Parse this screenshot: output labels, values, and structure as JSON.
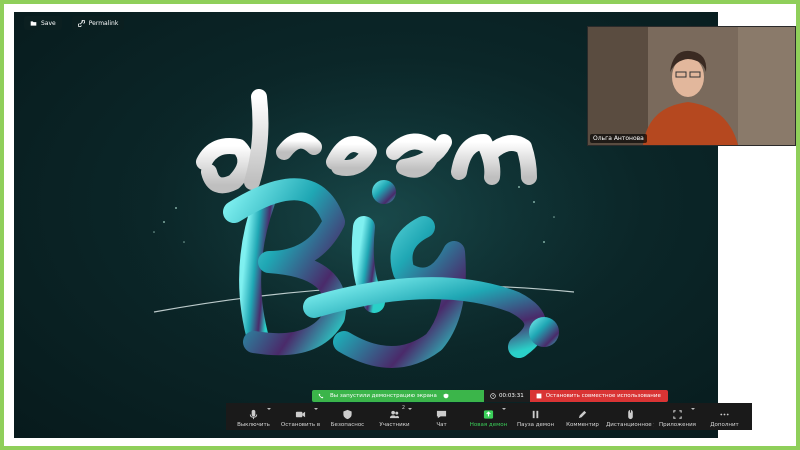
{
  "share_toolbar": {
    "save_label": "Save",
    "permalink_label": "Permalink"
  },
  "artwork": {
    "word_top": "dream",
    "word_bottom": "Big."
  },
  "video": {
    "participant_name": "Ольга Антонова"
  },
  "share_notice": {
    "message": "Вы запустили демонстрацию экрана",
    "timer": "00:03:31",
    "stop_label": "Остановить совместное использование"
  },
  "controls": {
    "mute": "Выключить",
    "video": "Остановить в",
    "security": "Безопаснос",
    "participants": "Участники",
    "participants_count": "2",
    "chat": "Чат",
    "new_share": "Новая демон",
    "pause_share": "Пауза демон",
    "annotate": "Комментир",
    "remote_control": "Дистанционное у",
    "apps": "Приложения",
    "more": "Дополнит"
  },
  "colors": {
    "frame_border": "#8fcf5a",
    "share_green": "#3bb54a",
    "stop_red": "#d93434",
    "active_green": "#3bd05a"
  }
}
